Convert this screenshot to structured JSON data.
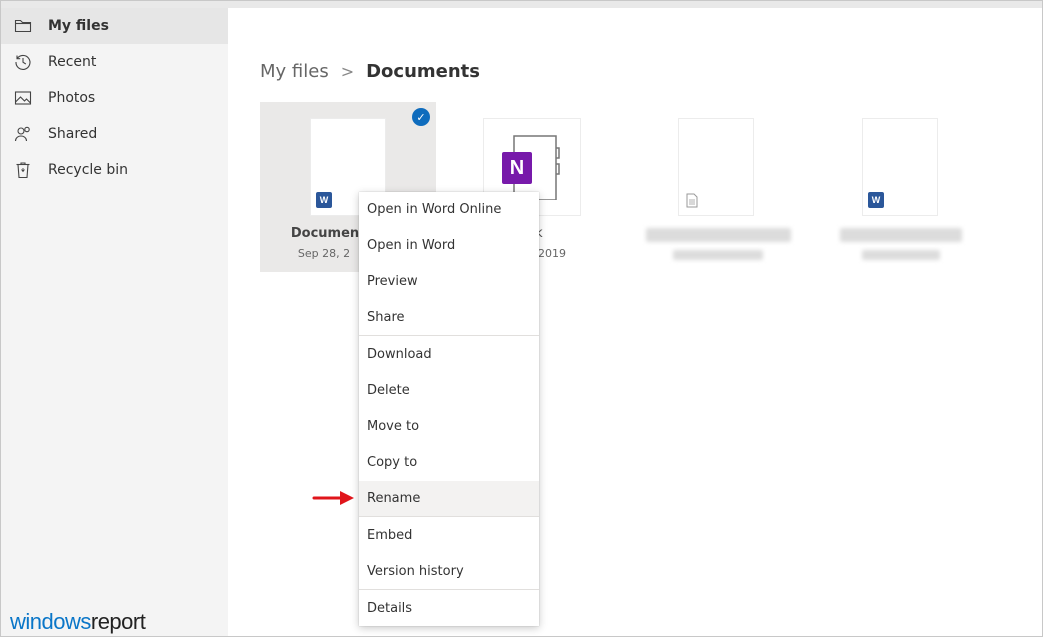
{
  "sidebar": {
    "items": [
      {
        "label": "My files",
        "icon": "folder-icon",
        "active": true
      },
      {
        "label": "Recent",
        "icon": "history-icon"
      },
      {
        "label": "Photos",
        "icon": "photo-icon"
      },
      {
        "label": "Shared",
        "icon": "people-icon"
      },
      {
        "label": "Recycle bin",
        "icon": "recycle-bin-icon"
      }
    ]
  },
  "breadcrumb": {
    "root": "My files",
    "separator": ">",
    "current": "Documents"
  },
  "files": [
    {
      "name": "Documen",
      "date": "Sep 28, 2",
      "type": "word",
      "selected": true
    },
    {
      "name": "ebook",
      "date": "2019",
      "type": "onenote",
      "icon_letter": "N"
    },
    {
      "name": "",
      "type": "generic",
      "blurred": true
    },
    {
      "name": "",
      "type": "word",
      "blurred": true
    }
  ],
  "context_menu": {
    "items": [
      "Open in Word Online",
      "Open in Word",
      "Preview",
      "Share",
      "Download",
      "Delete",
      "Move to",
      "Copy to",
      "Rename",
      "Embed",
      "Version history",
      "Details"
    ],
    "highlighted": "Rename"
  },
  "watermark": {
    "part1": "windows",
    "part2": "report"
  },
  "colors": {
    "sidebar_bg": "#f4f4f4",
    "active_bg": "#e6e6e6",
    "word_blue": "#2b579a",
    "onenote_purple": "#7719aa",
    "check_blue": "#0f6cbd",
    "arrow_red": "#e0151b"
  }
}
